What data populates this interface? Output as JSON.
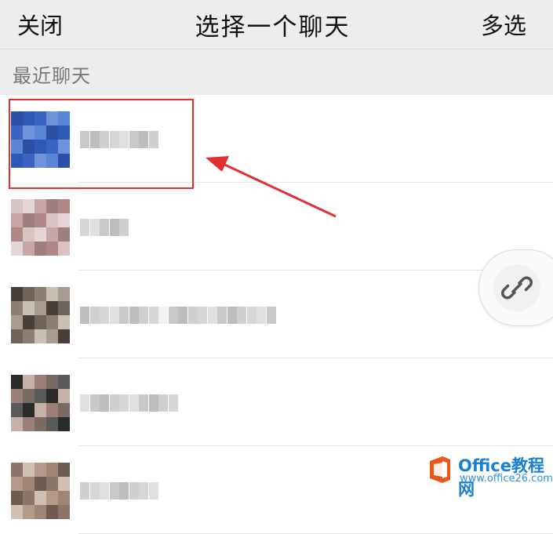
{
  "header": {
    "close_label": "关闭",
    "title": "选择一个聊天",
    "multi_select_label": "多选"
  },
  "section": {
    "label": "最近聊天"
  },
  "chats": [
    {
      "avatar_colors": [
        "#2c4fa6",
        "#3a64c4",
        "#5a86d8",
        "#2e5ab5",
        "#6f92d9"
      ],
      "name_block_count": 8,
      "highlighted": true
    },
    {
      "avatar_colors": [
        "#d9c4c4",
        "#c9a6a6",
        "#b08787",
        "#e4d6d6",
        "#9e7f7f"
      ],
      "name_block_count": 5,
      "highlighted": false
    },
    {
      "avatar_colors": [
        "#4a3f38",
        "#8c7f72",
        "#a89c90",
        "#6e645b",
        "#c8bfb5"
      ],
      "name_block_count": 20,
      "highlighted": false
    },
    {
      "avatar_colors": [
        "#2a2a2a",
        "#9c7f78",
        "#5a5a5a",
        "#c4b2aa",
        "#7a6a66"
      ],
      "name_block_count": 10,
      "highlighted": false
    },
    {
      "avatar_colors": [
        "#8a7568",
        "#b49a88",
        "#6e5c52",
        "#d0c0b4",
        "#a08474"
      ],
      "name_block_count": 8,
      "highlighted": false
    }
  ],
  "float_button": {
    "icon": "link-icon"
  },
  "watermark": {
    "brand": "Office教程网",
    "url": "www.office26.com"
  },
  "colors": {
    "highlight": "#e03030",
    "arrow": "#e03030",
    "watermark": "#1a80d0",
    "watermark_logo": "#e8561c"
  }
}
